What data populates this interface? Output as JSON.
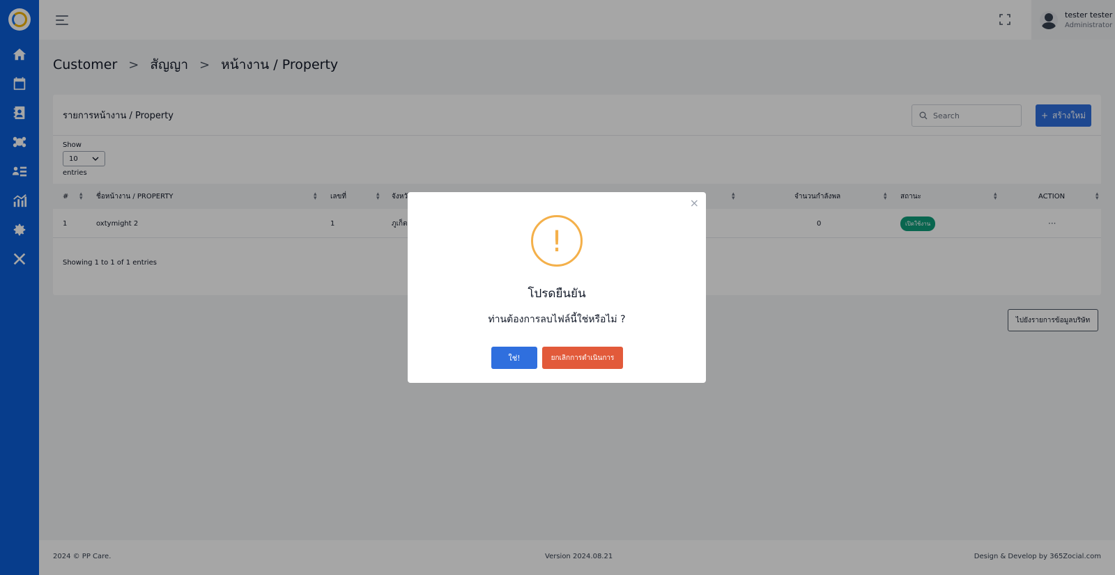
{
  "topbar": {
    "user_name": "tester tester",
    "user_role": "Administrator"
  },
  "breadcrumb": {
    "items": [
      "Customer",
      "สัญญา",
      "หน้างาน / Property"
    ],
    "separator": ">"
  },
  "card": {
    "title": "รายการหน้างาน / Property",
    "search_placeholder": "Search",
    "create_label": "สร้างใหม่",
    "create_icon": "+",
    "show_label": "Show",
    "page_length": "10",
    "entries_label": "entries",
    "columns": [
      "#",
      "ชื่อหน้างาน / PROPERTY",
      "เลขที่",
      "จังหวัด",
      "",
      "จำนวนกำลังพล",
      "สถานะ",
      "ACTION"
    ],
    "rows": [
      {
        "no": "1",
        "name": "oxtymight 2",
        "number": "1",
        "province": "ภูเก็ต",
        "staff": "0",
        "status": "เปิดใช้งาน",
        "action": "···"
      }
    ],
    "showing_text": "Showing 1 to 1 of 1 entries"
  },
  "goto_button": "ไปยังรายการข้อมูลบริษัท",
  "footer": {
    "left": "2024 © PP Care.",
    "center": "Version 2024.08.21",
    "right": "Design & Develop by 365Zocial.com"
  },
  "modal": {
    "close": "×",
    "icon_symbol": "!",
    "title": "โปรดยืนยัน",
    "text": "ท่านต้องการลบไฟล์นี้ใช่หรือไม่ ?",
    "confirm_label": "ใช่!",
    "cancel_label": "ยกเลิกการดำเนินการ"
  },
  "colors": {
    "sidebar": "#0b5ed7",
    "primary": "#2f6fde",
    "danger": "#e25a3a",
    "warning": "#f4b04a",
    "status_active": "#0f9d7a"
  }
}
